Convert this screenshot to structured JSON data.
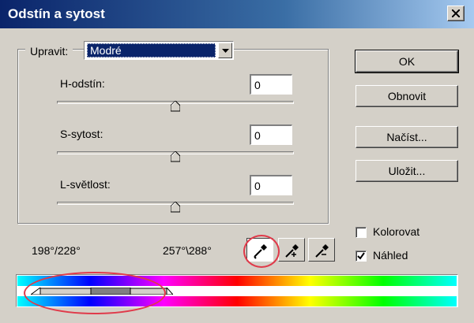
{
  "window": {
    "title": "Odstín a sytost"
  },
  "edit": {
    "label": "Upravit:",
    "selected": "Modré"
  },
  "sliders": [
    {
      "label": "H-odstín:",
      "value": "0",
      "position": 0.5
    },
    {
      "label": "S-sytost:",
      "value": "0",
      "position": 0.5
    },
    {
      "label": "L-světlost:",
      "value": "0",
      "position": 0.5
    }
  ],
  "buttons": {
    "ok": "OK",
    "reset": "Obnovit",
    "load": "Načíst...",
    "save": "Uložit..."
  },
  "checkboxes": {
    "colorize": {
      "label": "Kolorovat",
      "checked": false
    },
    "preview": {
      "label": "Náhled",
      "checked": true
    }
  },
  "range": {
    "left": "198°/228°",
    "right": "257°\\288°"
  },
  "tools": [
    {
      "name": "eyedropper-icon",
      "pressed": true
    },
    {
      "name": "eyedropper-plus-icon",
      "pressed": false
    },
    {
      "name": "eyedropper-minus-icon",
      "pressed": false
    }
  ],
  "colors": {
    "annotation": "#e03a4a",
    "selection": "#0a246a"
  }
}
